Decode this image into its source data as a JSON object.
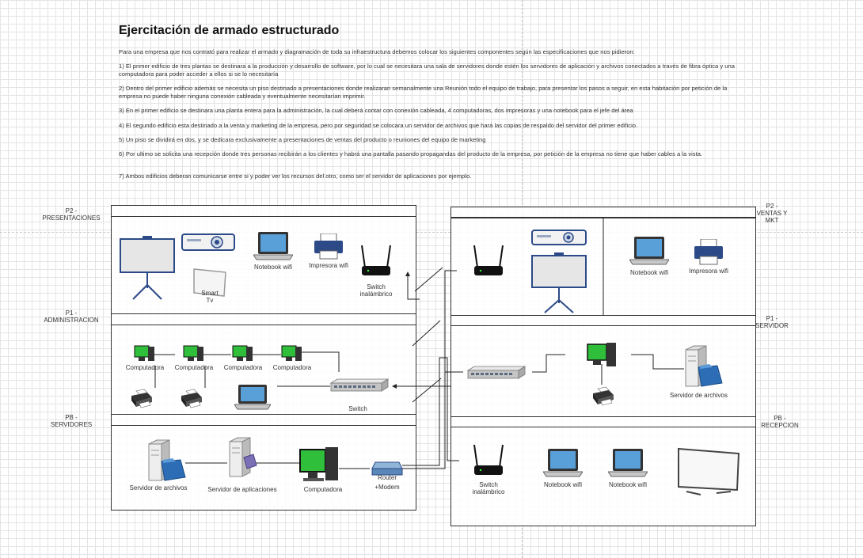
{
  "title": "Ejercitación de armado estructurado",
  "paragraphs": [
    "Para una empresa que  nos contrató para realizar el armado y diagramación de toda su infraestructura debemos colocar los siguientes componentes según las especificaciones que nos pidieron:",
    "1) El primer edificio de tres plantas se destinara a la producción y desarrollo de software, por lo cual se necesitara una sala de servidores donde estén los servidores de aplicación y archivos conectados a través de fibra óptica y una computadora para poder acceder a ellos si se lo necesitaría",
    "2) Dentro del primer edificio además se necesita un piso destinado a presentaciones donde realizaran semanalmente una Reunión todo el equipo de trabajo, para presentar los pasos a seguir, en esta habitación por petición de la empresa no puede haber ninguna conexión cableada y eventualmente necesitarían imprimir.",
    "3) En el primer edificio se destinara una planta entera para la administración, la cual deberá contar con conexión cableada, 4 computadoras, dos impresoras y una notebook para el jefe del área",
    "4) El segundo edificio esta destinado a la venta y marketing de la empresa, pero por seguridad se colocara un servidor de archivos que hará las copias de respaldo del servidor del primer edificio.",
    "5) Un piso se dividirá en dos, y se dedicara exclusivamente a presentaciones de ventas del producto o reuniones del equipo de marketing",
    "6) Por ultimo se solicita una recepción donde tres personas recibirán a los clientes y habrá una pantalla pasando propagandas del producto de la empresa, por petición de la empresa no tiene que haber cables a la vista.",
    "7) Ambos edificios deberan comunicarse entre si y poder ver los recursos del otro, como ser el servidor de aplicaciones por ejemplo."
  ],
  "floors": {
    "b1_p2": "P2 -\nPRESENTACIONES",
    "b1_p1": "P1 -\nADMINISTRACION",
    "b1_pb": "PB -\nSERVIDORES",
    "b2_p2": "P2 -\nVENTAS Y\nMKT",
    "b2_p1": "P1 -\nSERVIDOR",
    "b2_pb": "PB -\nRECEPCION"
  },
  "labels": {
    "notebook_wifi": "Notebook wifi",
    "impresora_wifi": "Impresora wifi",
    "switch_inalambrico": "Switch\ninalámbrico",
    "smart_tv": "Smart\nTv",
    "computadora": "Computadora",
    "switch": "Switch",
    "servidor_archivos": "Servidor de archivos",
    "servidor_aplicaciones": "Servidor de aplicaciones",
    "router_modem": "Router\n+Modem"
  },
  "colors": {
    "border": "#333333",
    "screen": "#5aa0d8",
    "monitor_green": "#2fbf3a",
    "printer_blue": "#2c4a88"
  }
}
